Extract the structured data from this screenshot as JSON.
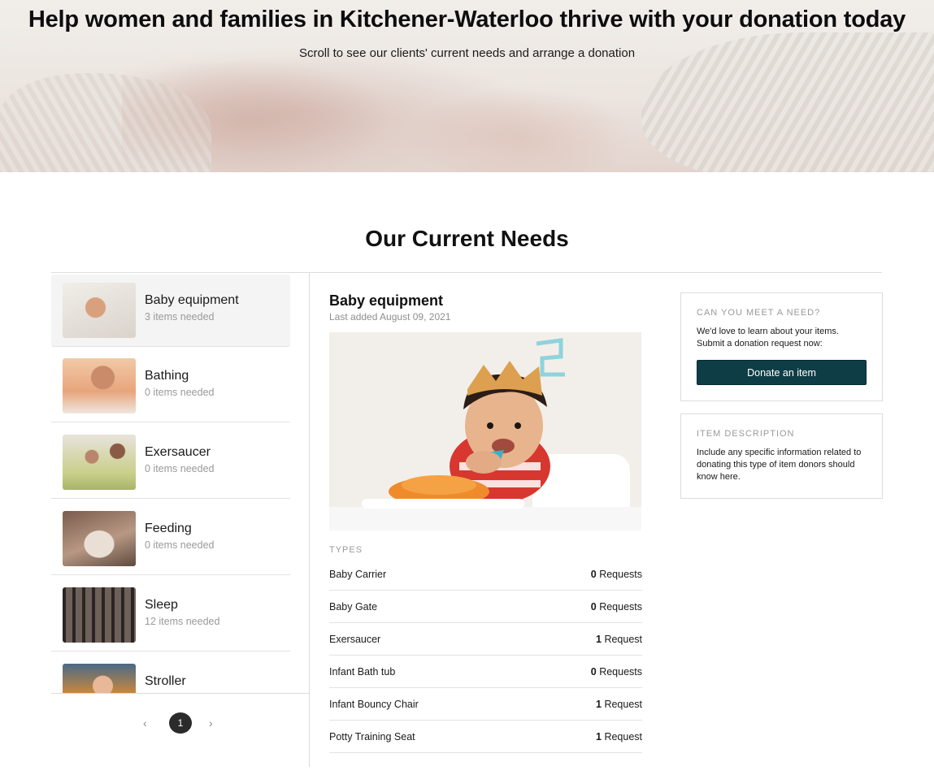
{
  "hero": {
    "title": "Help women and families in Kitchener-Waterloo thrive with your donation today",
    "subtitle": "Scroll to see our clients' current needs and arrange a donation"
  },
  "section_title": "Our Current Needs",
  "categories": [
    {
      "name": "Baby equipment",
      "count": "3 items needed",
      "active": true
    },
    {
      "name": "Bathing",
      "count": "0 items needed",
      "active": false
    },
    {
      "name": "Exersaucer",
      "count": "0 items needed",
      "active": false
    },
    {
      "name": "Feeding",
      "count": "0 items needed",
      "active": false
    },
    {
      "name": "Sleep",
      "count": "12 items needed",
      "active": false
    },
    {
      "name": "Stroller",
      "count": "",
      "active": false
    }
  ],
  "pagination": {
    "prev": "‹",
    "current": "1",
    "next": "›"
  },
  "detail": {
    "title": "Baby equipment",
    "last_added": "Last added August 09, 2021",
    "types_label": "TYPES",
    "types": [
      {
        "name": "Baby Carrier",
        "count": "0",
        "unit": "Requests"
      },
      {
        "name": "Baby Gate",
        "count": "0",
        "unit": "Requests"
      },
      {
        "name": "Exersaucer",
        "count": "1",
        "unit": "Request"
      },
      {
        "name": "Infant Bath tub",
        "count": "0",
        "unit": "Requests"
      },
      {
        "name": "Infant Bouncy Chair",
        "count": "1",
        "unit": "Request"
      },
      {
        "name": "Potty Training Seat",
        "count": "1",
        "unit": "Request"
      }
    ]
  },
  "meet_card": {
    "title": "CAN YOU MEET A NEED?",
    "text_line1": "We'd love to learn about your items.",
    "text_line2": "Submit a donation request now:",
    "button": "Donate an item"
  },
  "desc_card": {
    "title": "ITEM DESCRIPTION",
    "text_line1": "Include any specific information related to",
    "text_line2": "donating this type of item donors should",
    "text_line3": "know here."
  },
  "colors": {
    "button_bg": "#0f3d45",
    "active_item_bg": "#f4f4f4",
    "muted_text": "#9a9a9a"
  }
}
